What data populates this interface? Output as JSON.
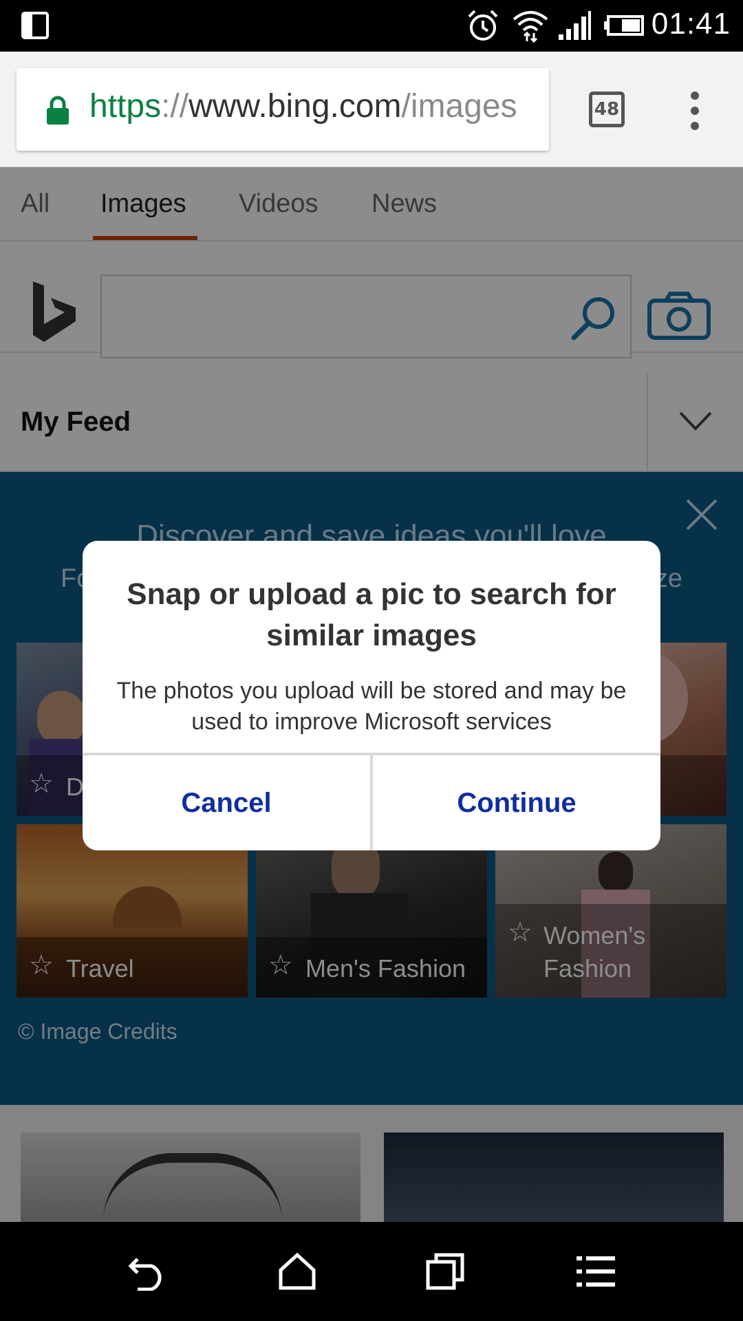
{
  "status_bar": {
    "time": "01:41",
    "icons": [
      "screen-rotate-icon",
      "alarm-icon",
      "wifi-icon",
      "cell-signal-icon",
      "battery-icon"
    ]
  },
  "browser": {
    "url_scheme": "https",
    "url_sep": "://",
    "url_host": "www.bing.com",
    "url_path": "/images",
    "tab_count": "48",
    "secure_color": "#0b8043"
  },
  "nav_tabs": [
    {
      "label": "All"
    },
    {
      "label": "Images"
    },
    {
      "label": "Videos"
    },
    {
      "label": "News"
    }
  ],
  "active_tab": "Images",
  "search": {
    "placeholder": "",
    "value": ""
  },
  "feed": {
    "title": "My Feed"
  },
  "promo": {
    "headline": "Discover and save ideas you'll love",
    "sub_left": "Fo",
    "sub_right": "ze",
    "tiles": [
      {
        "label": "D"
      },
      {
        "label": ""
      },
      {
        "label": ""
      },
      {
        "label": "Travel"
      },
      {
        "label": "Men's Fashion"
      },
      {
        "label": "Women's Fashion"
      }
    ],
    "credits": "© Image Credits",
    "background": "#0e5a86"
  },
  "dialog": {
    "title": "Snap or upload a pic to search for similar images",
    "message": "The photos you upload will be stored and may be used to improve Microsoft services",
    "cancel_label": "Cancel",
    "continue_label": "Continue",
    "button_color": "#0e2ea1"
  },
  "colors": {
    "tab_accent": "#c9400e",
    "bing_blue": "#1a73a8"
  }
}
